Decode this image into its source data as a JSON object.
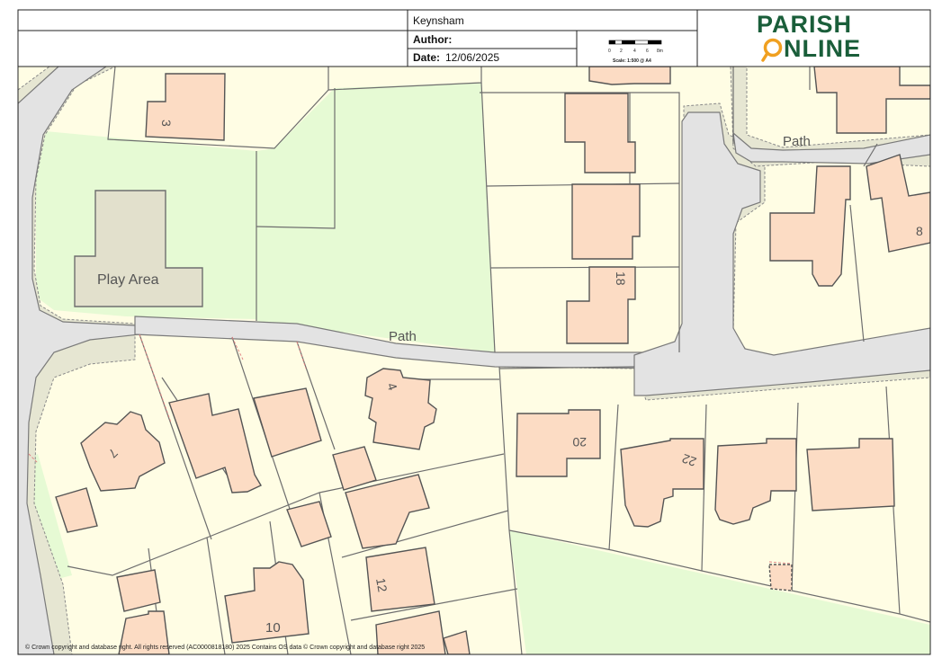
{
  "header": {
    "location": "Keynsham",
    "author_label": "Author:",
    "author_value": "",
    "date_label": "Date:",
    "date_value": "12/06/2025"
  },
  "scale_bar": {
    "ticks": [
      "0",
      "2",
      "4",
      "6",
      "8m"
    ],
    "scale_label": "Scale: 1:500 @ A4"
  },
  "logo": {
    "line1": "PARISH",
    "line2_rest": "NLINE",
    "color": "#1a5e3a",
    "accent": "#f0a020"
  },
  "map": {
    "labels": {
      "play_area": "Play Area",
      "path_main": "Path",
      "path_upper": "Path"
    },
    "house_numbers": {
      "n3": "3",
      "n4": "4",
      "n7": "7",
      "n8": "8",
      "n10": "10",
      "n12": "12",
      "n18": "18",
      "n20": "20",
      "n22": "22"
    },
    "colors": {
      "land": "#fffde4",
      "green": "#e6fad4",
      "road": "#e3e3e3",
      "verge": "#e6e6d2",
      "building": "#fcdcc4",
      "play": "#e2e0cc",
      "line": "#6e6e6e"
    }
  },
  "copyright": "© Crown copyright and database right. All rights reserved (AC0000818180) 2025 Contains OS data © Crown copyright and database right 2025"
}
